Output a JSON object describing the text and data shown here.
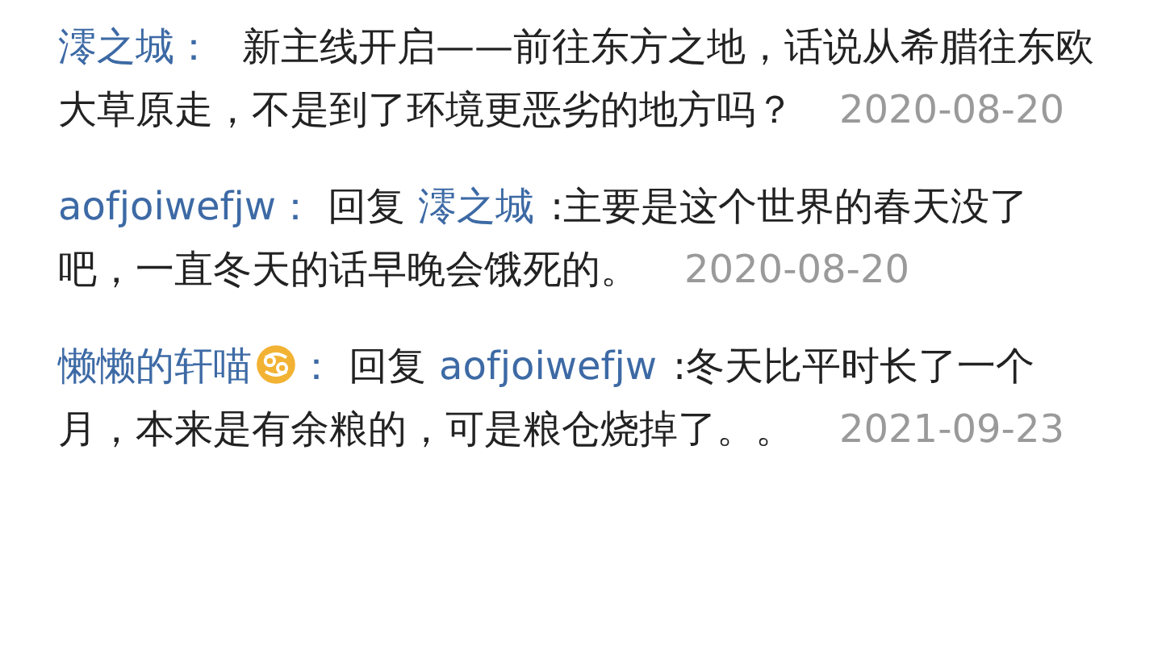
{
  "comments": [
    {
      "author": "澪之城",
      "badge": false,
      "separator": "：",
      "text": "新主线开启——前往东方之地，话说从希腊往东欧大草原走，不是到了环境更恶劣的地方吗？",
      "date": "2020-08-20"
    },
    {
      "author": "aofjoiwefjw",
      "badge": false,
      "separator": "：",
      "reply_label": "回复",
      "reply_to": "澪之城",
      "text": ":主要是这个世界的春天没了吧，一直冬天的话早晚会饿死的。",
      "date": "2020-08-20"
    },
    {
      "author": "懒懒的轩喵",
      "badge": true,
      "separator": "：",
      "reply_label": "回复",
      "reply_to": "aofjoiwefjw",
      "text": ":冬天比平时长了一个月，本来是有余粮的，可是粮仓烧掉了。。",
      "date": "2021-09-23"
    }
  ]
}
